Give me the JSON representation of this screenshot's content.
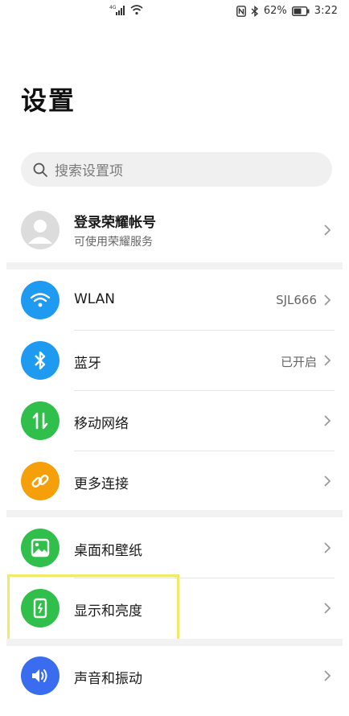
{
  "status_bar": {
    "battery": "62%",
    "time": "3:22"
  },
  "page": {
    "title": "设置"
  },
  "search": {
    "placeholder": "搜索设置项"
  },
  "account": {
    "title": "登录荣耀帐号",
    "subtitle": "可使用荣耀服务"
  },
  "items": [
    {
      "label": "WLAN",
      "value": "SJL666",
      "icon": "wifi-icon",
      "color": "#1e9bf0"
    },
    {
      "label": "蓝牙",
      "value": "已开启",
      "icon": "bluetooth-icon",
      "color": "#1e9bf0"
    },
    {
      "label": "移动网络",
      "value": "",
      "icon": "mobile-data-icon",
      "color": "#2fbf4a"
    },
    {
      "label": "更多连接",
      "value": "",
      "icon": "link-icon",
      "color": "#f5a00a"
    },
    {
      "label": "桌面和壁纸",
      "value": "",
      "icon": "wallpaper-icon",
      "color": "#2fbf4a"
    },
    {
      "label": "显示和亮度",
      "value": "",
      "icon": "display-icon",
      "color": "#2fbf4a"
    },
    {
      "label": "声音和振动",
      "value": "",
      "icon": "sound-icon",
      "color": "#3a6cf0"
    }
  ]
}
